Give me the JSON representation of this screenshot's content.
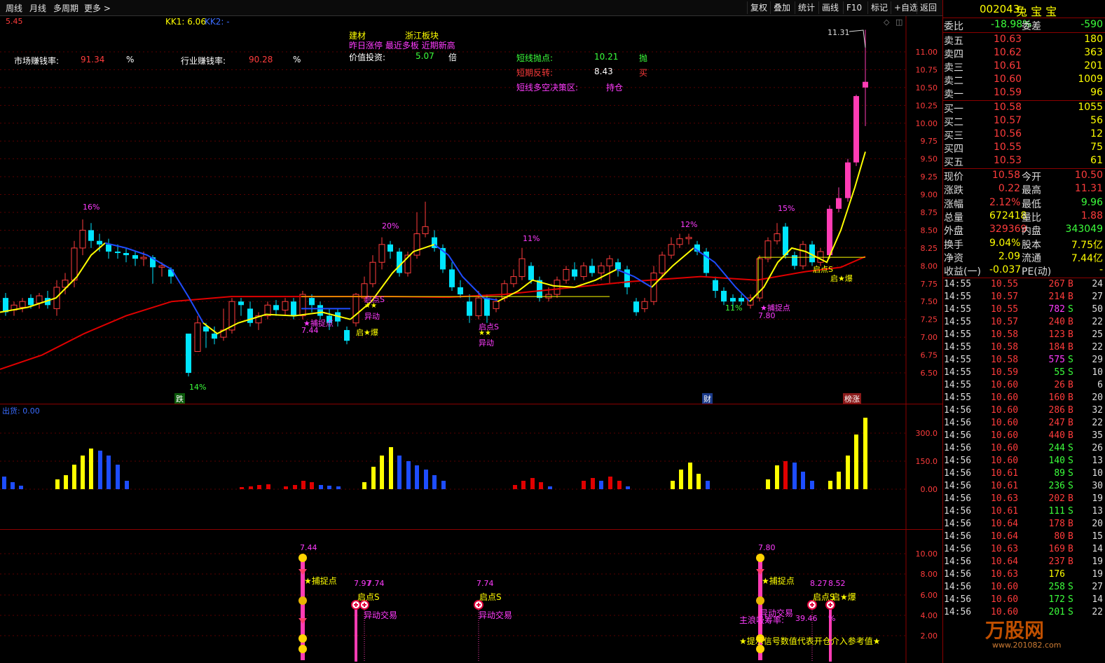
{
  "toolbar": {
    "left": [
      "周线",
      "月线",
      "多周期",
      "更多 >"
    ],
    "right": [
      "复权",
      "叠加",
      "统计",
      "画线",
      "F10",
      "标记",
      "+自选",
      "返回"
    ]
  },
  "main": {
    "header_left": "5.45",
    "kk1": "KK1: 6.06",
    "kk2": "KK2: -",
    "market_label": "市场赚钱率:",
    "market_value": "91.34",
    "market_unit": "%",
    "industry_label": "行业赚钱率:",
    "industry_value": "90.28",
    "industry_unit": "%",
    "sector1": "建材",
    "sector2": "浙江板块",
    "news": "昨日涨停 最近多板 近期新高",
    "value_label": "价值投资:",
    "value_num": "5.07",
    "value_unit": "倍",
    "short_top_label": "短线抛点:",
    "short_top_value": "10.21",
    "short_top_action": "抛",
    "short_rev_label": "短期反转:",
    "short_rev_value": "8.43",
    "short_rev_action": "买",
    "short_zone_label": "短线多空决策区:",
    "short_zone_action": "持仓",
    "price_axis": [
      "11.00",
      "10.75",
      "10.50",
      "10.25",
      "10.00",
      "9.75",
      "9.50",
      "9.25",
      "9.00",
      "8.75",
      "8.50",
      "8.25",
      "8.00",
      "7.75",
      "7.50",
      "7.25",
      "7.00",
      "6.75",
      "6.50"
    ],
    "high_label": "11.31",
    "annotations": [
      "16%",
      "20%",
      "11%",
      "12%",
      "15%",
      "14%",
      "11%",
      "★捕捉点",
      "7.44",
      "启点S",
      "★★",
      "异动",
      "启★爆",
      "启点S",
      "★★",
      "异动",
      "★捕捉点",
      "7.80",
      "启点S",
      "启★爆"
    ],
    "bottom_tags": [
      "跌",
      "财",
      "榜涨"
    ]
  },
  "volume": {
    "label": "出货: 0.00",
    "axis": [
      "300.0",
      "150.0",
      "0.00"
    ]
  },
  "signal": {
    "axis": [
      "10.00",
      "8.00",
      "6.00",
      "4.00",
      "2.00"
    ],
    "labels": [
      "7.44",
      "★捕捉点",
      "7.97",
      "7.74",
      "启点S",
      "异动交易",
      "7.74",
      "启点S",
      "异动交易",
      "7.80",
      "★捕捉点",
      "异动交易",
      "主浪吸筹率:",
      "39.46",
      "%",
      "8.27",
      "8.52",
      "启点S",
      "启★爆",
      "★提示信号数值代表开仓介入参考值★"
    ]
  },
  "quote": {
    "code": "002043",
    "name": "兔 宝 宝",
    "weibi_label": "委比",
    "weibi": "-18.98%",
    "weicha_label": "委差",
    "weicha": "-590",
    "sells": [
      {
        "label": "卖五",
        "price": "10.63",
        "vol": "180"
      },
      {
        "label": "卖四",
        "price": "10.62",
        "vol": "363"
      },
      {
        "label": "卖三",
        "price": "10.61",
        "vol": "201"
      },
      {
        "label": "卖二",
        "price": "10.60",
        "vol": "1009"
      },
      {
        "label": "卖一",
        "price": "10.59",
        "vol": "96"
      }
    ],
    "buys": [
      {
        "label": "买一",
        "price": "10.58",
        "vol": "1055"
      },
      {
        "label": "买二",
        "price": "10.57",
        "vol": "56"
      },
      {
        "label": "买三",
        "price": "10.56",
        "vol": "12"
      },
      {
        "label": "买四",
        "price": "10.55",
        "vol": "75"
      },
      {
        "label": "买五",
        "price": "10.53",
        "vol": "61"
      }
    ],
    "stats": [
      {
        "l1": "现价",
        "v1": "10.58",
        "c1": "#ff3c3c",
        "l2": "今开",
        "v2": "10.50",
        "c2": "#ff3c3c"
      },
      {
        "l1": "涨跌",
        "v1": "0.22",
        "c1": "#ff3c3c",
        "l2": "最高",
        "v2": "11.31",
        "c2": "#ff3c3c"
      },
      {
        "l1": "涨幅",
        "v1": "2.12%",
        "c1": "#ff3c3c",
        "l2": "最低",
        "v2": "9.96",
        "c2": "#3cff3c"
      },
      {
        "l1": "总量",
        "v1": "672418",
        "c1": "#ffff00",
        "l2": "量比",
        "v2": "1.88",
        "c2": "#ff3c3c"
      },
      {
        "l1": "外盘",
        "v1": "329369",
        "c1": "#ff3c3c",
        "l2": "内盘",
        "v2": "343049",
        "c2": "#3cff3c"
      },
      {
        "l1": "换手",
        "v1": "9.04%",
        "c1": "#ffff00",
        "l2": "股本",
        "v2": "7.75亿",
        "c2": "#ffff00"
      },
      {
        "l1": "净资",
        "v1": "2.09",
        "c1": "#ffff00",
        "l2": "流通",
        "v2": "7.44亿",
        "c2": "#ffff00"
      },
      {
        "l1": "收益(一)",
        "v1": "-0.037",
        "c1": "#ffff00",
        "l2": "PE(动)",
        "v2": "-",
        "c2": "#ffff00"
      }
    ],
    "ticks": [
      [
        "14:55",
        "10.55",
        "267",
        "B",
        "24"
      ],
      [
        "14:55",
        "10.57",
        "214",
        "B",
        "27"
      ],
      [
        "14:55",
        "10.55",
        "782",
        "S",
        "50"
      ],
      [
        "14:55",
        "10.57",
        "240",
        "B",
        "22"
      ],
      [
        "14:55",
        "10.58",
        "123",
        "B",
        "25"
      ],
      [
        "14:55",
        "10.58",
        "184",
        "B",
        "22"
      ],
      [
        "14:55",
        "10.58",
        "575",
        "S",
        "29"
      ],
      [
        "14:55",
        "10.59",
        "55",
        "S",
        "10"
      ],
      [
        "14:55",
        "10.60",
        "26",
        "B",
        "6"
      ],
      [
        "14:55",
        "10.60",
        "160",
        "B",
        "20"
      ],
      [
        "14:56",
        "10.60",
        "286",
        "B",
        "32"
      ],
      [
        "14:56",
        "10.60",
        "247",
        "B",
        "22"
      ],
      [
        "14:56",
        "10.60",
        "440",
        "B",
        "35"
      ],
      [
        "14:56",
        "10.60",
        "244",
        "S",
        "26"
      ],
      [
        "14:56",
        "10.60",
        "140",
        "S",
        "13"
      ],
      [
        "14:56",
        "10.61",
        "89",
        "S",
        "10"
      ],
      [
        "14:56",
        "10.61",
        "236",
        "S",
        "30"
      ],
      [
        "14:56",
        "10.63",
        "202",
        "B",
        "19"
      ],
      [
        "14:56",
        "10.61",
        "111",
        "S",
        "13"
      ],
      [
        "14:56",
        "10.64",
        "178",
        "B",
        "20"
      ],
      [
        "14:56",
        "10.64",
        "80",
        "B",
        "15"
      ],
      [
        "14:56",
        "10.63",
        "169",
        "B",
        "14"
      ],
      [
        "14:56",
        "10.64",
        "237",
        "B",
        "19"
      ],
      [
        "14:56",
        "10.63",
        "176",
        "",
        "19"
      ],
      [
        "14:56",
        "10.60",
        "258",
        "S",
        "27"
      ],
      [
        "14:56",
        "10.60",
        "172",
        "S",
        "14"
      ],
      [
        "14:56",
        "10.60",
        "201",
        "S",
        "22"
      ]
    ],
    "watermark": "万股网",
    "watermark_sub": "www.201082.com"
  }
}
